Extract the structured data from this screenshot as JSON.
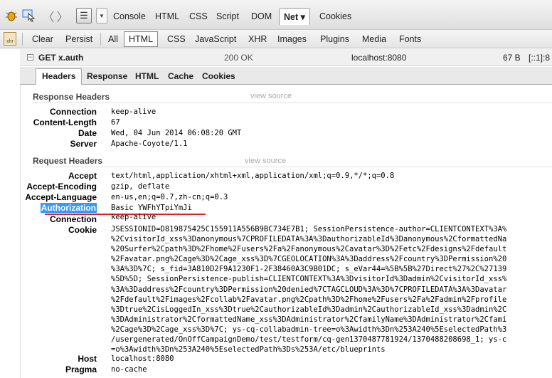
{
  "toolbar": {
    "command_line_glyph": "☰",
    "panels": [
      "Console",
      "HTML",
      "CSS",
      "Script",
      "DOM",
      "Net ▾",
      "Cookies"
    ],
    "selected_panel": "Net ▾"
  },
  "net_toolbar": {
    "xhr_icon_text": "xhr",
    "clear": "Clear",
    "persist": "Persist",
    "filters": [
      "All",
      "HTML",
      "CSS",
      "JavaScript",
      "XHR",
      "Images",
      "Plugins",
      "Media",
      "Fonts"
    ],
    "selected_filter": "HTML"
  },
  "request": {
    "toggle": "−",
    "url": "GET x.auth",
    "status": "200 OK",
    "host": "localhost:8080",
    "size": "67 B",
    "remote_ip": "[::1]:8"
  },
  "detail_tabs": [
    "Headers",
    "Response",
    "HTML",
    "Cache",
    "Cookies"
  ],
  "response_headers": {
    "title": "Response Headers",
    "view_source": "view source",
    "rows": [
      {
        "name": "Connection",
        "value": "keep-alive"
      },
      {
        "name": "Content-Length",
        "value": "67"
      },
      {
        "name": "Date",
        "value": "Wed, 04 Jun 2014 06:08:20 GMT"
      },
      {
        "name": "Server",
        "value": "Apache-Coyote/1.1"
      }
    ]
  },
  "request_headers": {
    "title": "Request Headers",
    "view_source": "view source",
    "rows": [
      {
        "name": "Accept",
        "value": "text/html,application/xhtml+xml,application/xml;q=0.9,*/*;q=0.8"
      },
      {
        "name": "Accept-Encoding",
        "value": "gzip, deflate"
      },
      {
        "name": "Accept-Language",
        "value": "en-us,en;q=0.7,zh-cn;q=0.3"
      },
      {
        "name": "Authorization",
        "value": "Basic YWFhYTpiYmJi"
      },
      {
        "name": "Connection",
        "value": "keep-alive"
      }
    ],
    "cookie_name": "Cookie",
    "cookie_lines": [
      "JSESSIONID=D819875425C155911A556B9BC734E7B1; SessionPersistence-author=CLIENTCONTEXT%3A%",
      "%2CvisitorId_xss%3Danonymous%7CPROFILEDATA%3A%3DauthorizableId%3Danonymous%2CformattedNa",
      "%20Surfer%2Cpath%3D%2Fhome%2Fusers%2Fa%2Fanonymous%2Cavatar%3D%2Fetc%2Fdesigns%2Fdefault",
      "%2Favatar.png%2Cage%3D%2Cage_xss%3D%7CGEOLOCATION%3A%3Daddress%2Fcountry%3DPermission%20",
      "%3A%3D%7C; s_fid=3A810D2F9A1230F1-2F38460A3C9B01DC; s_eVar44=%5B%5B%27Direct%27%2C%27139",
      "%5D%5D; SessionPersistence-publish=CLIENTCONTEXT%3A%3DvisitorId%3Dadmin%2CvisitorId_xss%",
      "%3A%3Daddress%2Fcountry%3DPermission%20denied%7CTAGCLOUD%3A%3D%7CPROFILEDATA%3A%3Davatar",
      "%2Fdefault%2Fimages%2Fcollab%2Favatar.png%2Cpath%3D%2Fhome%2Fusers%2Fa%2Fadmin%2Fprofile",
      "%3Dtrue%2CisLoggedIn_xss%3Dtrue%2CauthorizableId%3Dadmin%2CauthorizableId_xss%3Dadmin%2C",
      "%3DAdministrator%2CformattedName_xss%3DAdministrator%2CfamilyName%3DAdministrator%2Cfami",
      "%2Cage%3D%2Cage_xss%3D%7C; ys-cq-collabadmin-tree=o%3Awidth%3Dn%253A240%5EselectedPath%3",
      "/usergenerated/OnOffCampaignDemo/test/testform/cq-gen1370487781924/1370488208698_1; ys-c",
      "=o%3Awidth%3Dn%253A240%5EselectedPath%3Ds%253A/etc/blueprints"
    ],
    "tail_rows": [
      {
        "name": "Host",
        "value": "localhost:8080"
      },
      {
        "name": "Pragma",
        "value": "no-cache"
      }
    ]
  },
  "colors": {
    "selection_highlight": "#3399ff",
    "annotation_underline": "#d8232a"
  }
}
